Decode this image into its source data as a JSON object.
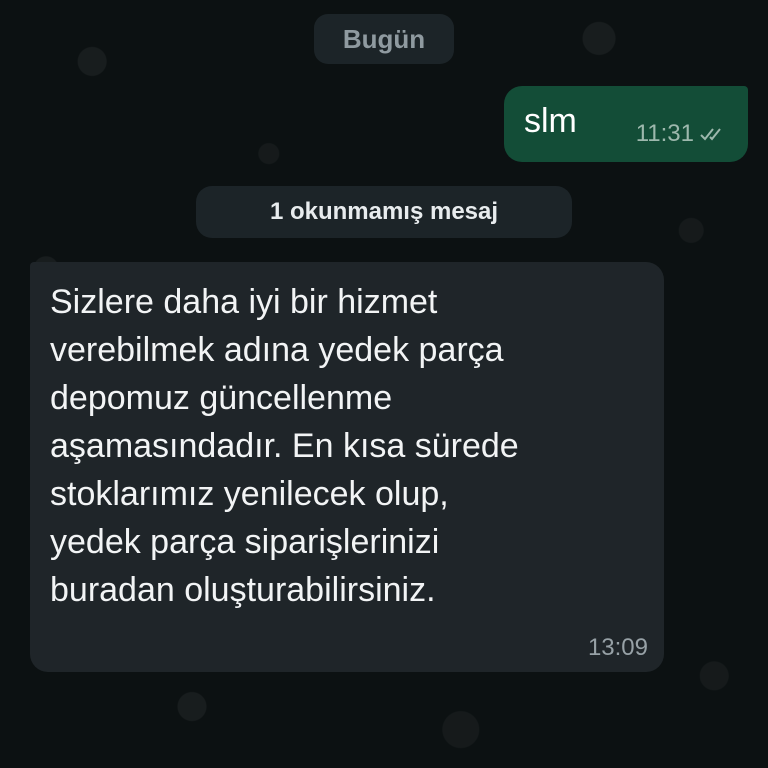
{
  "date_divider": "Bugün",
  "outgoing_message": {
    "text": "slm",
    "time": "11:31",
    "status_icon": "double-check-icon"
  },
  "unread_divider": "1 okunmamış mesaj",
  "incoming_message": {
    "text": "Sizlere daha iyi bir hizmet\nverebilmek adına yedek parça\ndepomuz güncellenme\naşamasındadır. En kısa sürede\nstoklarımız yenilecek olup,\nyedek parça siparişlerinizi\nburadan oluşturabilirsiniz.",
    "time": "13:09"
  },
  "colors": {
    "background": "#0c1112",
    "outgoing_bubble": "#134d37",
    "incoming_bubble": "#1f2529",
    "chip": "#1c2428"
  }
}
